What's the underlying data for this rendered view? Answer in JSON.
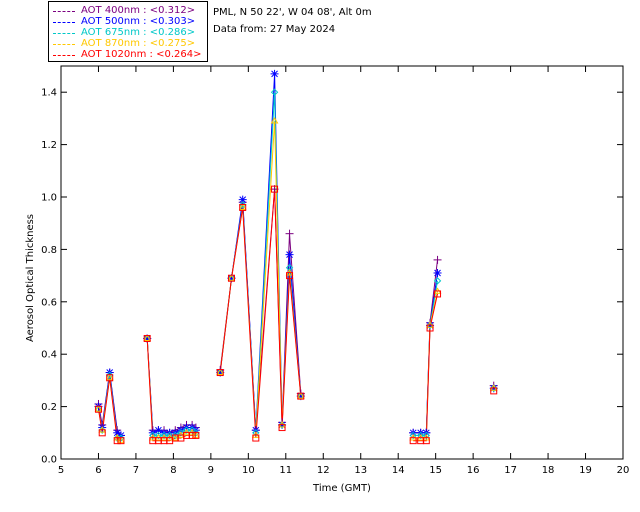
{
  "info": {
    "station": "PML, N 50 22', W 04 08', Alt 0m",
    "date": "Data from: 27 May 2024"
  },
  "chart_data": {
    "type": "line",
    "xlabel": "Time (GMT)",
    "ylabel": "Aerosol Optical Thickness",
    "xlim": [
      5,
      20
    ],
    "ylim": [
      0,
      1.5
    ],
    "x_ticks": [
      "5",
      "6",
      "7",
      "8",
      "9",
      "10",
      "11",
      "12",
      "13",
      "14",
      "15",
      "16",
      "17",
      "18",
      "19",
      "20"
    ],
    "y_ticks": [
      "0.0",
      "0.2",
      "0.4",
      "0.6",
      "0.8",
      "1.0",
      "1.2",
      "1.4"
    ],
    "grid": false,
    "legend_position": "top-left outside",
    "series": [
      {
        "name": "AOT  400nm : <0.312>",
        "color": "#7b0080",
        "marker": "plus",
        "points": [
          [
            6.0,
            0.21
          ],
          [
            6.1,
            0.13
          ],
          [
            6.3,
            0.33
          ],
          [
            6.5,
            0.11
          ],
          [
            6.6,
            0.09
          ],
          [
            7.3,
            0.46
          ],
          [
            7.45,
            0.11
          ],
          [
            7.6,
            0.11
          ],
          [
            7.75,
            0.11
          ],
          [
            7.9,
            0.1
          ],
          [
            8.05,
            0.11
          ],
          [
            8.2,
            0.12
          ],
          [
            8.35,
            0.13
          ],
          [
            8.5,
            0.13
          ],
          [
            8.6,
            0.12
          ],
          [
            9.25,
            0.34
          ],
          [
            9.55,
            0.69
          ],
          [
            9.85,
            0.98
          ],
          [
            10.2,
            0.11
          ],
          [
            10.7,
            1.03
          ],
          [
            10.9,
            0.14
          ],
          [
            11.1,
            0.86
          ],
          [
            11.4,
            0.25
          ],
          [
            14.4,
            0.1
          ],
          [
            14.6,
            0.1
          ],
          [
            14.75,
            0.1
          ],
          [
            14.85,
            0.52
          ],
          [
            15.05,
            0.76
          ],
          [
            16.55,
            0.28
          ]
        ]
      },
      {
        "name": "AOT  500nm : <0.303>",
        "color": "#0000ff",
        "marker": "asterisk",
        "points": [
          [
            6.0,
            0.2
          ],
          [
            6.1,
            0.12
          ],
          [
            6.3,
            0.33
          ],
          [
            6.5,
            0.1
          ],
          [
            6.6,
            0.09
          ],
          [
            7.3,
            0.46
          ],
          [
            7.45,
            0.1
          ],
          [
            7.6,
            0.11
          ],
          [
            7.75,
            0.1
          ],
          [
            7.9,
            0.1
          ],
          [
            8.05,
            0.1
          ],
          [
            8.2,
            0.11
          ],
          [
            8.35,
            0.12
          ],
          [
            8.5,
            0.12
          ],
          [
            8.6,
            0.11
          ],
          [
            9.25,
            0.33
          ],
          [
            9.55,
            0.69
          ],
          [
            9.85,
            0.99
          ],
          [
            10.2,
            0.11
          ],
          [
            10.7,
            1.47
          ],
          [
            10.9,
            0.13
          ],
          [
            11.1,
            0.78
          ],
          [
            11.4,
            0.24
          ],
          [
            14.4,
            0.1
          ],
          [
            14.6,
            0.1
          ],
          [
            14.75,
            0.1
          ],
          [
            14.85,
            0.51
          ],
          [
            15.05,
            0.71
          ],
          [
            16.55,
            0.27
          ]
        ]
      },
      {
        "name": "AOT  675nm : <0.286>",
        "color": "#00c8c8",
        "marker": "diamond",
        "points": [
          [
            6.0,
            0.19
          ],
          [
            6.1,
            0.11
          ],
          [
            6.3,
            0.32
          ],
          [
            6.5,
            0.08
          ],
          [
            6.6,
            0.08
          ],
          [
            7.3,
            0.46
          ],
          [
            7.45,
            0.09
          ],
          [
            7.6,
            0.09
          ],
          [
            7.75,
            0.09
          ],
          [
            7.9,
            0.09
          ],
          [
            8.05,
            0.09
          ],
          [
            8.2,
            0.1
          ],
          [
            8.35,
            0.11
          ],
          [
            8.5,
            0.11
          ],
          [
            8.6,
            0.1
          ],
          [
            9.25,
            0.33
          ],
          [
            9.55,
            0.69
          ],
          [
            9.85,
            0.97
          ],
          [
            10.2,
            0.1
          ],
          [
            10.7,
            1.4
          ],
          [
            10.9,
            0.13
          ],
          [
            11.1,
            0.73
          ],
          [
            11.4,
            0.24
          ],
          [
            14.4,
            0.09
          ],
          [
            14.6,
            0.09
          ],
          [
            14.75,
            0.09
          ],
          [
            14.85,
            0.51
          ],
          [
            15.05,
            0.68
          ],
          [
            16.55,
            0.27
          ]
        ]
      },
      {
        "name": "AOT  870nm : <0.275>",
        "color": "#ffc800",
        "marker": "triangle",
        "points": [
          [
            6.0,
            0.19
          ],
          [
            6.1,
            0.11
          ],
          [
            6.3,
            0.31
          ],
          [
            6.5,
            0.08
          ],
          [
            6.6,
            0.07
          ],
          [
            7.3,
            0.46
          ],
          [
            7.45,
            0.08
          ],
          [
            7.6,
            0.08
          ],
          [
            7.75,
            0.08
          ],
          [
            7.9,
            0.08
          ],
          [
            8.05,
            0.08
          ],
          [
            8.2,
            0.09
          ],
          [
            8.35,
            0.1
          ],
          [
            8.5,
            0.1
          ],
          [
            8.6,
            0.09
          ],
          [
            9.25,
            0.33
          ],
          [
            9.55,
            0.69
          ],
          [
            9.85,
            0.96
          ],
          [
            10.2,
            0.09
          ],
          [
            10.7,
            1.29
          ],
          [
            10.9,
            0.13
          ],
          [
            11.1,
            0.71
          ],
          [
            11.4,
            0.24
          ],
          [
            14.4,
            0.08
          ],
          [
            14.6,
            0.08
          ],
          [
            14.75,
            0.08
          ],
          [
            14.85,
            0.51
          ],
          [
            15.05,
            0.64
          ],
          [
            16.55,
            0.27
          ]
        ]
      },
      {
        "name": "AOT 1020nm : <0.264>",
        "color": "#ff0000",
        "marker": "square",
        "points": [
          [
            6.0,
            0.19
          ],
          [
            6.1,
            0.1
          ],
          [
            6.3,
            0.31
          ],
          [
            6.5,
            0.07
          ],
          [
            6.6,
            0.07
          ],
          [
            7.3,
            0.46
          ],
          [
            7.45,
            0.07
          ],
          [
            7.6,
            0.07
          ],
          [
            7.75,
            0.07
          ],
          [
            7.9,
            0.07
          ],
          [
            8.05,
            0.08
          ],
          [
            8.2,
            0.08
          ],
          [
            8.35,
            0.09
          ],
          [
            8.5,
            0.09
          ],
          [
            8.6,
            0.09
          ],
          [
            9.25,
            0.33
          ],
          [
            9.55,
            0.69
          ],
          [
            9.85,
            0.96
          ],
          [
            10.2,
            0.08
          ],
          [
            10.7,
            1.03
          ],
          [
            10.9,
            0.12
          ],
          [
            11.1,
            0.7
          ],
          [
            11.4,
            0.24
          ],
          [
            14.4,
            0.07
          ],
          [
            14.6,
            0.07
          ],
          [
            14.75,
            0.07
          ],
          [
            14.85,
            0.5
          ],
          [
            15.05,
            0.63
          ],
          [
            16.55,
            0.26
          ]
        ]
      }
    ]
  }
}
